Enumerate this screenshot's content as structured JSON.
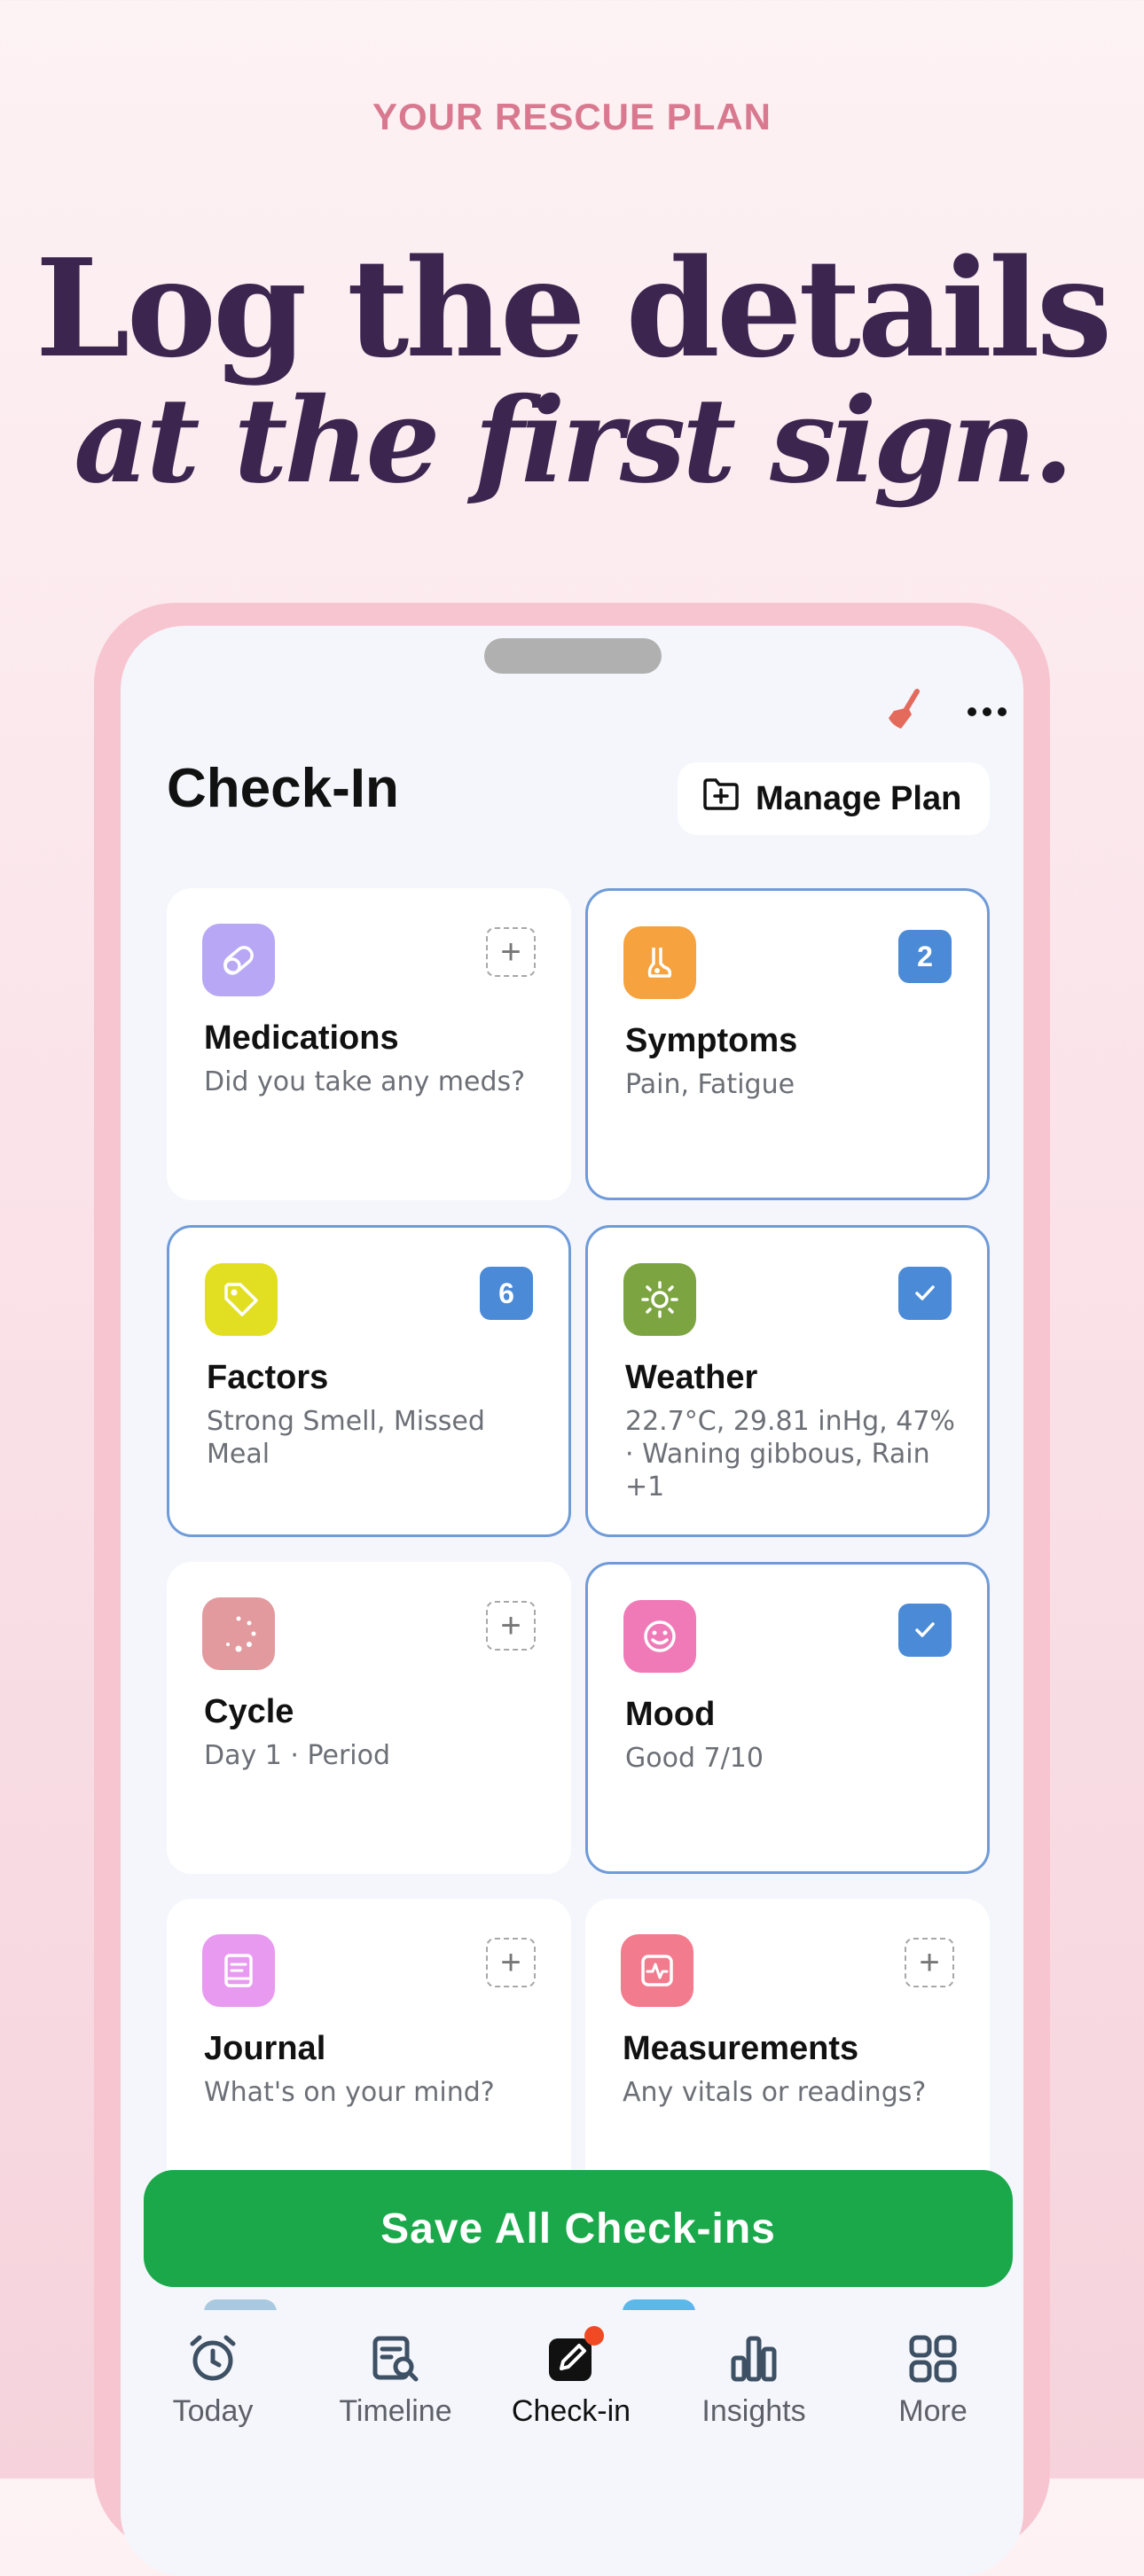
{
  "hero": {
    "eyebrow": "YOUR RESCUE PLAN",
    "line1": "Log the details",
    "line2": "at the first sign."
  },
  "header": {
    "title": "Check-In",
    "manage_plan_label": "Manage Plan",
    "broom_icon": "broom-icon",
    "more_icon": "more-horizontal-icon"
  },
  "cards": [
    {
      "title": "Medications",
      "subtitle": "Did you take any meds?",
      "icon": "pill-icon",
      "state": "add"
    },
    {
      "title": "Symptoms",
      "subtitle": "Pain, Fatigue",
      "icon": "body-icon",
      "state": "count",
      "badge": "2"
    },
    {
      "title": "Factors",
      "subtitle": "Strong Smell, Missed Meal",
      "icon": "tag-icon",
      "state": "count",
      "badge": "6"
    },
    {
      "title": "Weather",
      "subtitle": "22.7°C, 29.81 inHg, 47% · Waning gibbous, Rain +1",
      "icon": "sun-icon",
      "state": "checked"
    },
    {
      "title": "Cycle",
      "subtitle": "Day 1 · Period",
      "icon": "cycle-icon",
      "state": "add"
    },
    {
      "title": "Mood",
      "subtitle": "Good 7/10",
      "icon": "smile-icon",
      "state": "checked"
    },
    {
      "title": "Journal",
      "subtitle": "What's on your mind?",
      "icon": "journal-icon",
      "state": "add"
    },
    {
      "title": "Measurements",
      "subtitle": "Any vitals or readings?",
      "icon": "vitals-icon",
      "state": "add"
    }
  ],
  "save_button": "Save All Check-ins",
  "tabs": [
    {
      "label": "Today",
      "icon": "alarm-clock-icon"
    },
    {
      "label": "Timeline",
      "icon": "timeline-search-icon"
    },
    {
      "label": "Check-in",
      "icon": "pencil-square-icon",
      "active": true
    },
    {
      "label": "Insights",
      "icon": "bar-chart-icon"
    },
    {
      "label": "More",
      "icon": "grid-icon"
    }
  ],
  "colors": {
    "accent_green": "#1aa84a",
    "selected_border": "#6f9bd8",
    "badge_blue": "#4a8ad6",
    "headline": "#3c2650",
    "eyebrow": "#d8798f"
  }
}
